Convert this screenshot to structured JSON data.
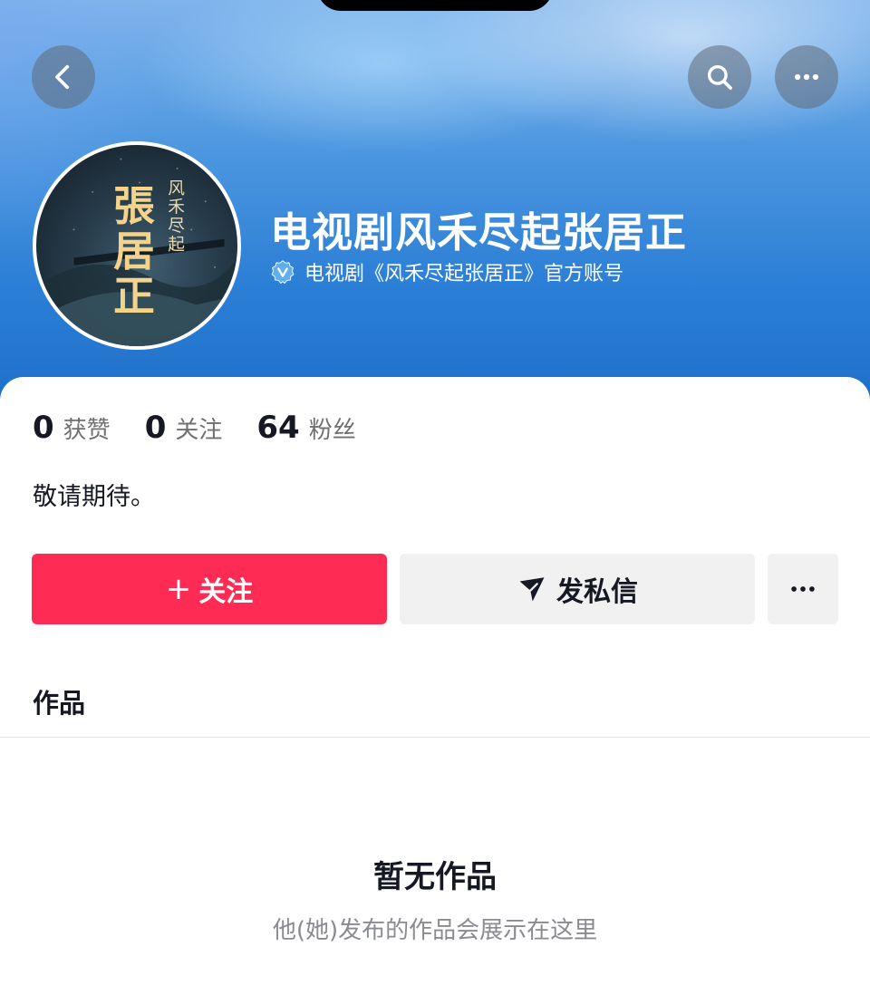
{
  "header": {
    "back_icon": "chevron-left-icon",
    "search_icon": "search-icon",
    "more_icon": "more-horizontal-icon"
  },
  "profile": {
    "name": "电视剧风禾尽起张居正",
    "verified_icon": "verified-badge-icon",
    "verification_text": "电视剧《风禾尽起张居正》官方账号",
    "bio": "敬请期待。",
    "avatar_text": {
      "big": [
        "張",
        "居",
        "正"
      ],
      "small": [
        "风",
        "禾",
        "尽",
        "起"
      ]
    }
  },
  "stats": [
    {
      "value": "0",
      "label": "获赞"
    },
    {
      "value": "0",
      "label": "关注"
    },
    {
      "value": "64",
      "label": "粉丝"
    }
  ],
  "actions": {
    "follow_plus": "+",
    "follow_label": "关注",
    "message_label": "发私信",
    "message_icon": "send-icon",
    "more_icon": "more-horizontal-icon"
  },
  "tabs": {
    "works": "作品"
  },
  "empty_state": {
    "title": "暂无作品",
    "subtitle": "他(她)发布的作品会展示在这里"
  },
  "colors": {
    "accent": "#fe2c55",
    "secondary_button": "#f1f1f2",
    "header_blue": "#2b7fd6"
  }
}
